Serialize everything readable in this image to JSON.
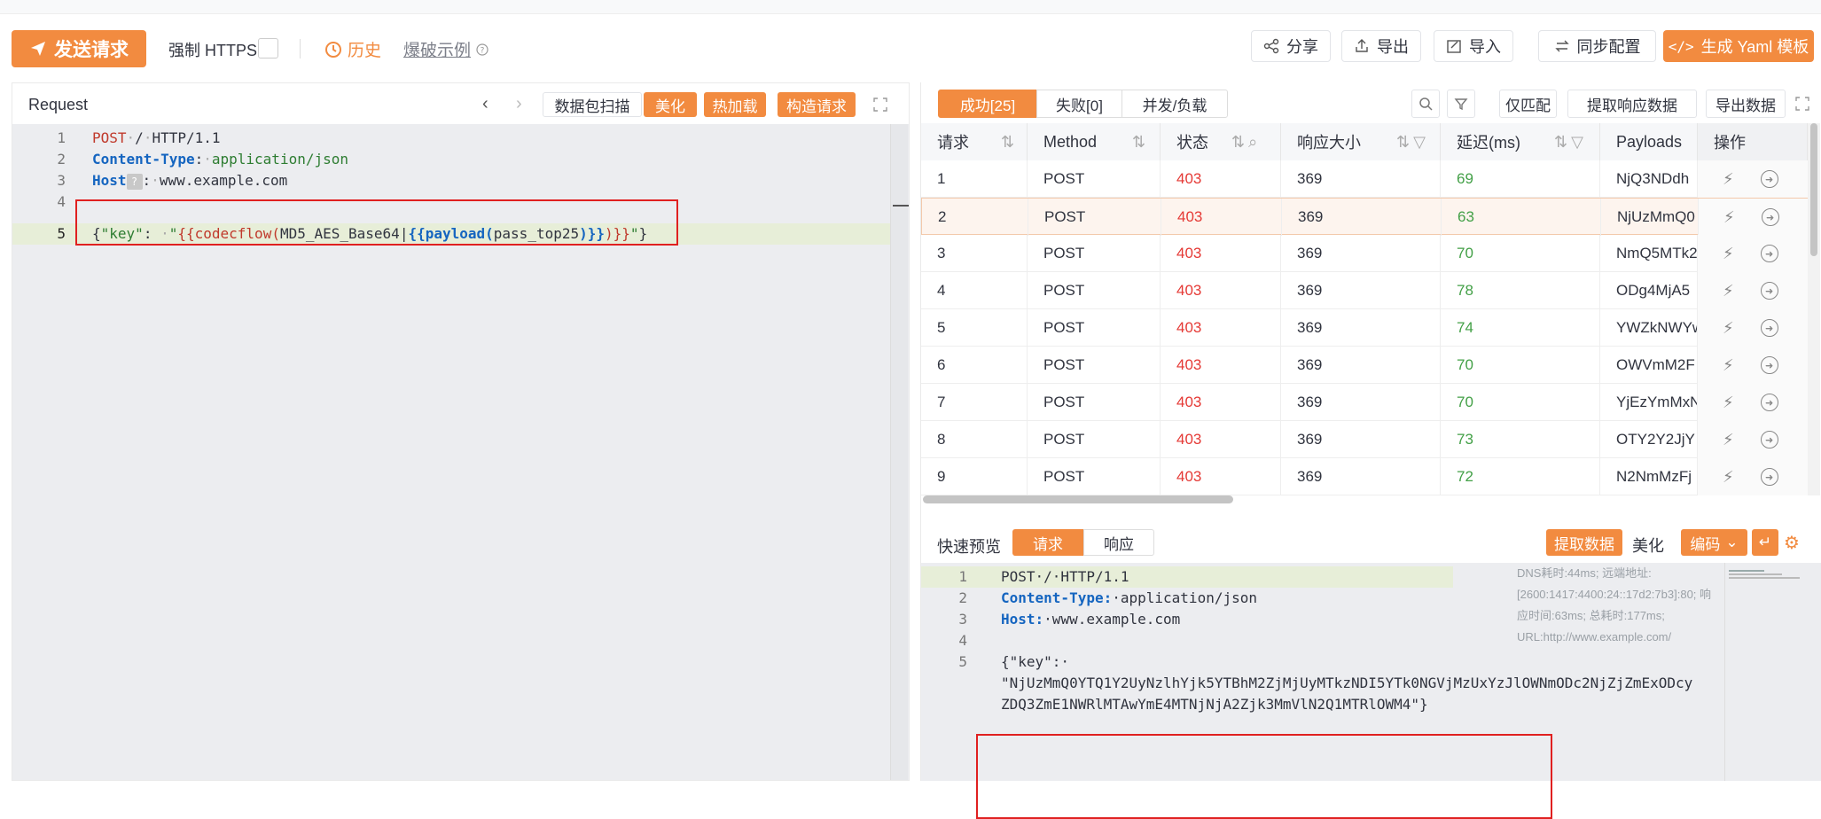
{
  "toolbar": {
    "send_label": "发送请求",
    "force_https_label": "强制 HTTPS",
    "history_label": "历史",
    "examples_label": "爆破示例",
    "share_label": "分享",
    "export_label": "导出",
    "import_label": "导入",
    "sync_label": "同步配置",
    "yaml_label": "生成 Yaml 模板"
  },
  "request": {
    "title": "Request",
    "buttons": [
      "数据包扫描",
      "美化",
      "热加载",
      "构造请求"
    ],
    "lines": [
      {
        "n": "1",
        "parts": [
          [
            "kw-red",
            "POST"
          ],
          [
            "dot",
            "·"
          ],
          [
            "",
            "/"
          ],
          [
            "dot",
            "·"
          ],
          [
            "",
            "HTTP/1.1"
          ]
        ]
      },
      {
        "n": "2",
        "parts": [
          [
            "kw-blue",
            "Content-Type"
          ],
          [
            "",
            ":"
          ],
          [
            "dot",
            "·"
          ],
          [
            "kw-green",
            "application/json"
          ]
        ]
      },
      {
        "n": "3",
        "parts": [
          [
            "kw-blue",
            "Host"
          ],
          [
            "q",
            "?"
          ],
          [
            "",
            ":"
          ],
          [
            "dot",
            "·"
          ],
          [
            "",
            "www.example.com"
          ]
        ]
      },
      {
        "n": "4",
        "parts": []
      },
      {
        "n": "5",
        "parts": [
          [
            "",
            "{"
          ],
          [
            "str",
            "\"key\""
          ],
          [
            "",
            ": "
          ],
          [
            "dot",
            "·"
          ],
          [
            "str",
            "\""
          ],
          [
            "kw-red",
            "{{codecflow("
          ],
          [
            "",
            "MD5_AES_Base64|"
          ],
          [
            "kw-blue",
            "{{payload("
          ],
          [
            "",
            "pass_top25"
          ],
          [
            "kw-blue",
            ")}}"
          ],
          [
            "kw-red",
            ")}}"
          ],
          [
            "str",
            "\""
          ],
          [
            "",
            "}"
          ]
        ]
      }
    ]
  },
  "results": {
    "tabs": [
      "成功[25]",
      "失败[0]",
      "并发/负载"
    ],
    "tools": [
      "仅匹配",
      "提取响应数据",
      "导出数据"
    ],
    "columns": [
      "请求",
      "Method",
      "状态",
      "响应大小",
      "延迟(ms)",
      "Payloads",
      "操作"
    ],
    "rows": [
      [
        "1",
        "POST",
        "403",
        "369",
        "69",
        "NjQ3NDdh"
      ],
      [
        "2",
        "POST",
        "403",
        "369",
        "63",
        "NjUzMmQ0"
      ],
      [
        "3",
        "POST",
        "403",
        "369",
        "70",
        "NmQ5MTk2"
      ],
      [
        "4",
        "POST",
        "403",
        "369",
        "78",
        "ODg4MjA5"
      ],
      [
        "5",
        "POST",
        "403",
        "369",
        "74",
        "YWZkNWYw"
      ],
      [
        "6",
        "POST",
        "403",
        "369",
        "70",
        "OWVmM2F"
      ],
      [
        "7",
        "POST",
        "403",
        "369",
        "70",
        "YjEzYmMxN"
      ],
      [
        "8",
        "POST",
        "403",
        "369",
        "73",
        "OTY2Y2JjY"
      ],
      [
        "9",
        "POST",
        "403",
        "369",
        "72",
        "N2NmMzFj"
      ]
    ],
    "selected_row": 2
  },
  "preview": {
    "label": "快速预览",
    "tabs": [
      "请求",
      "响应"
    ],
    "extract_label": "提取数据",
    "beautify_label": "美化",
    "encode_label": "编码",
    "lines": [
      {
        "n": "1",
        "text": "POST·/·HTTP/1.1"
      },
      {
        "n": "2",
        "key": "Content-Type:",
        "text": "·application/json"
      },
      {
        "n": "3",
        "key": "Host:",
        "text": "·www.example.com"
      },
      {
        "n": "4",
        "text": ""
      },
      {
        "n": "5",
        "text": "{\"key\":·"
      },
      {
        "n": "",
        "text": "\"NjUzMmQ0YTQ1Y2UyNzlhYjk5YTBhM2ZjMjUyMTkzNDI5YTk0NGVjMzUxYzJlOWNmODc2NjZjZmExODcy"
      },
      {
        "n": "",
        "text": "ZDQ3ZmE1NWRlMTAwYmE4MTNjNjA2Zjk3MmVlN2Q1MTRlOWM4\"}"
      }
    ],
    "meta": "DNS耗时:44ms; 远端地址:[2600:1417:4400:24::17d2:7b3]:80; 响应时间:63ms; 总耗时:177ms; URL:http://www.example.com/"
  }
}
